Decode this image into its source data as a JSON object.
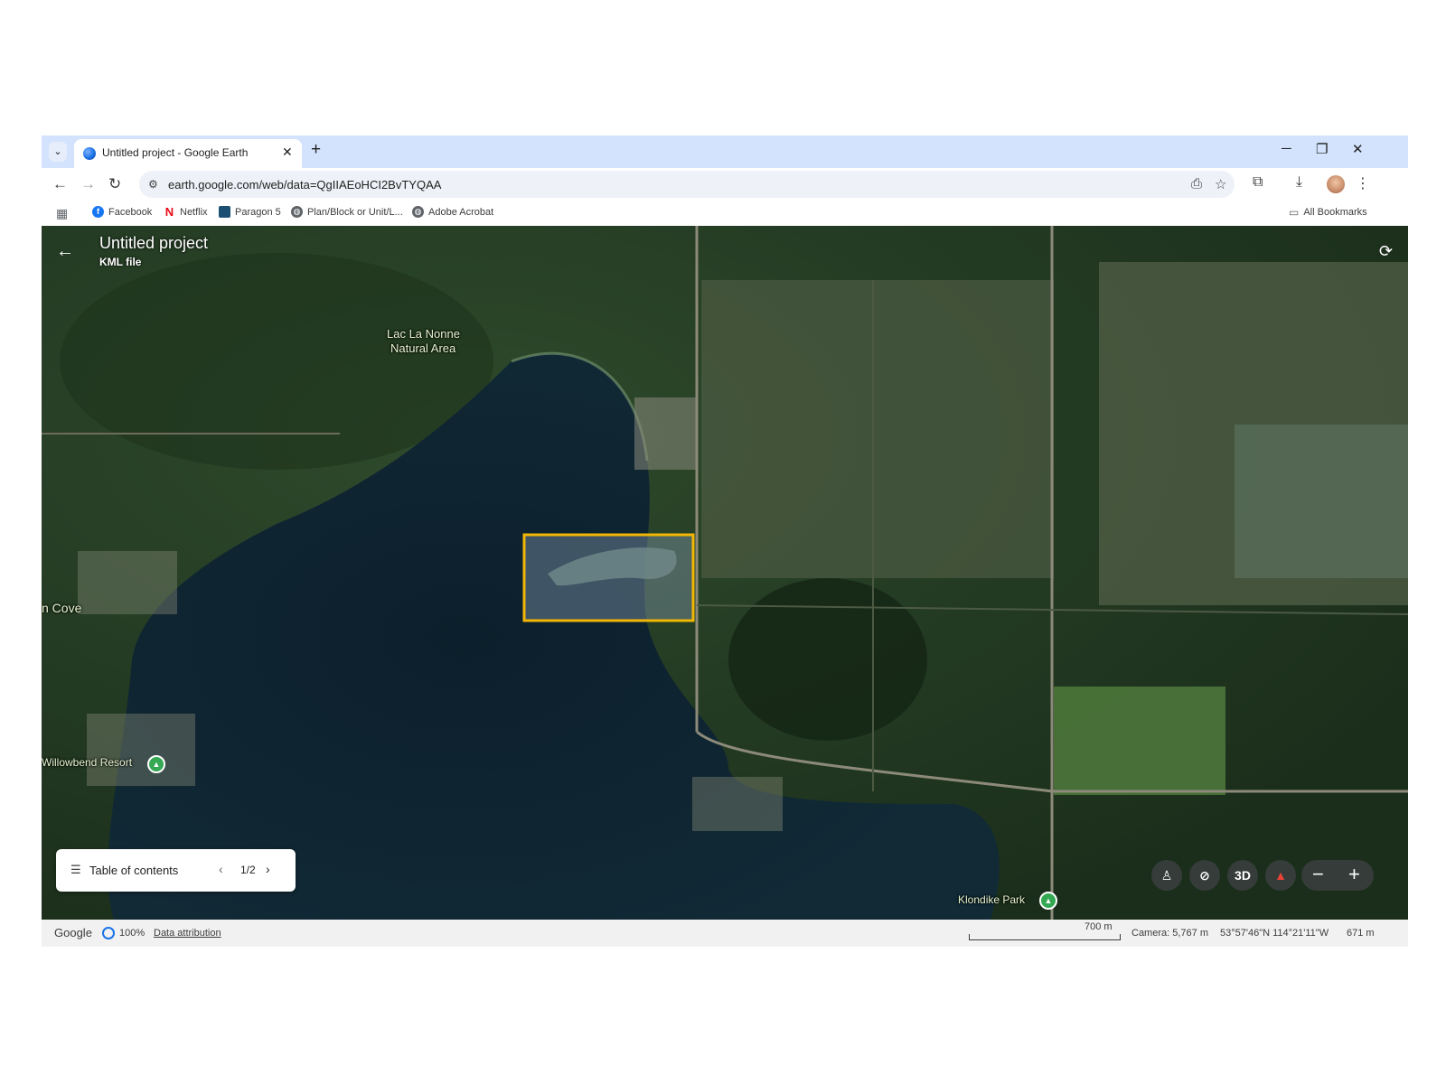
{
  "tab": {
    "title": "Untitled project - Google Earth",
    "close": "✕"
  },
  "new_tab": "+",
  "window_controls": {
    "minimize": "─",
    "restore": "❐",
    "close": "✕"
  },
  "address": {
    "url": "earth.google.com/web/data=QgIIAEoHCI2BvTYQAA"
  },
  "bookmarks": [
    {
      "label": "Facebook",
      "icon": "facebook-icon",
      "color": "#1877f2"
    },
    {
      "label": "Netflix",
      "icon": "netflix-icon",
      "color": "#e50914"
    },
    {
      "label": "Paragon 5",
      "icon": "paragon-icon",
      "color": "#1b4f72"
    },
    {
      "label": "Plan/Block or Unit/L...",
      "icon": "globe-icon",
      "color": "#5f6368"
    },
    {
      "label": "Adobe Acrobat",
      "icon": "globe-icon",
      "color": "#5f6368"
    }
  ],
  "all_bookmarks": "All Bookmarks",
  "project": {
    "title": "Untitled project",
    "subtitle": "KML file"
  },
  "map_labels": {
    "natural_area_line1": "Lac La Nonne",
    "natural_area_line2": "Natural Area",
    "cove": "n Cove",
    "resort": "Willowbend Resort",
    "park": "Klondike Park"
  },
  "toc": {
    "label": "Table of contents",
    "page": "1/2"
  },
  "controls": {
    "three_d": "3D"
  },
  "status": {
    "brand": "Google",
    "loading": "100%",
    "attribution": "Data attribution",
    "scale": "700 m",
    "camera": "Camera: 5,767 m",
    "coords": "53°57'46\"N 114°21'11\"W",
    "elevation": "671 m"
  },
  "colors": {
    "highlight_box": "#f2b705",
    "tab_strip": "#d3e3fd"
  }
}
